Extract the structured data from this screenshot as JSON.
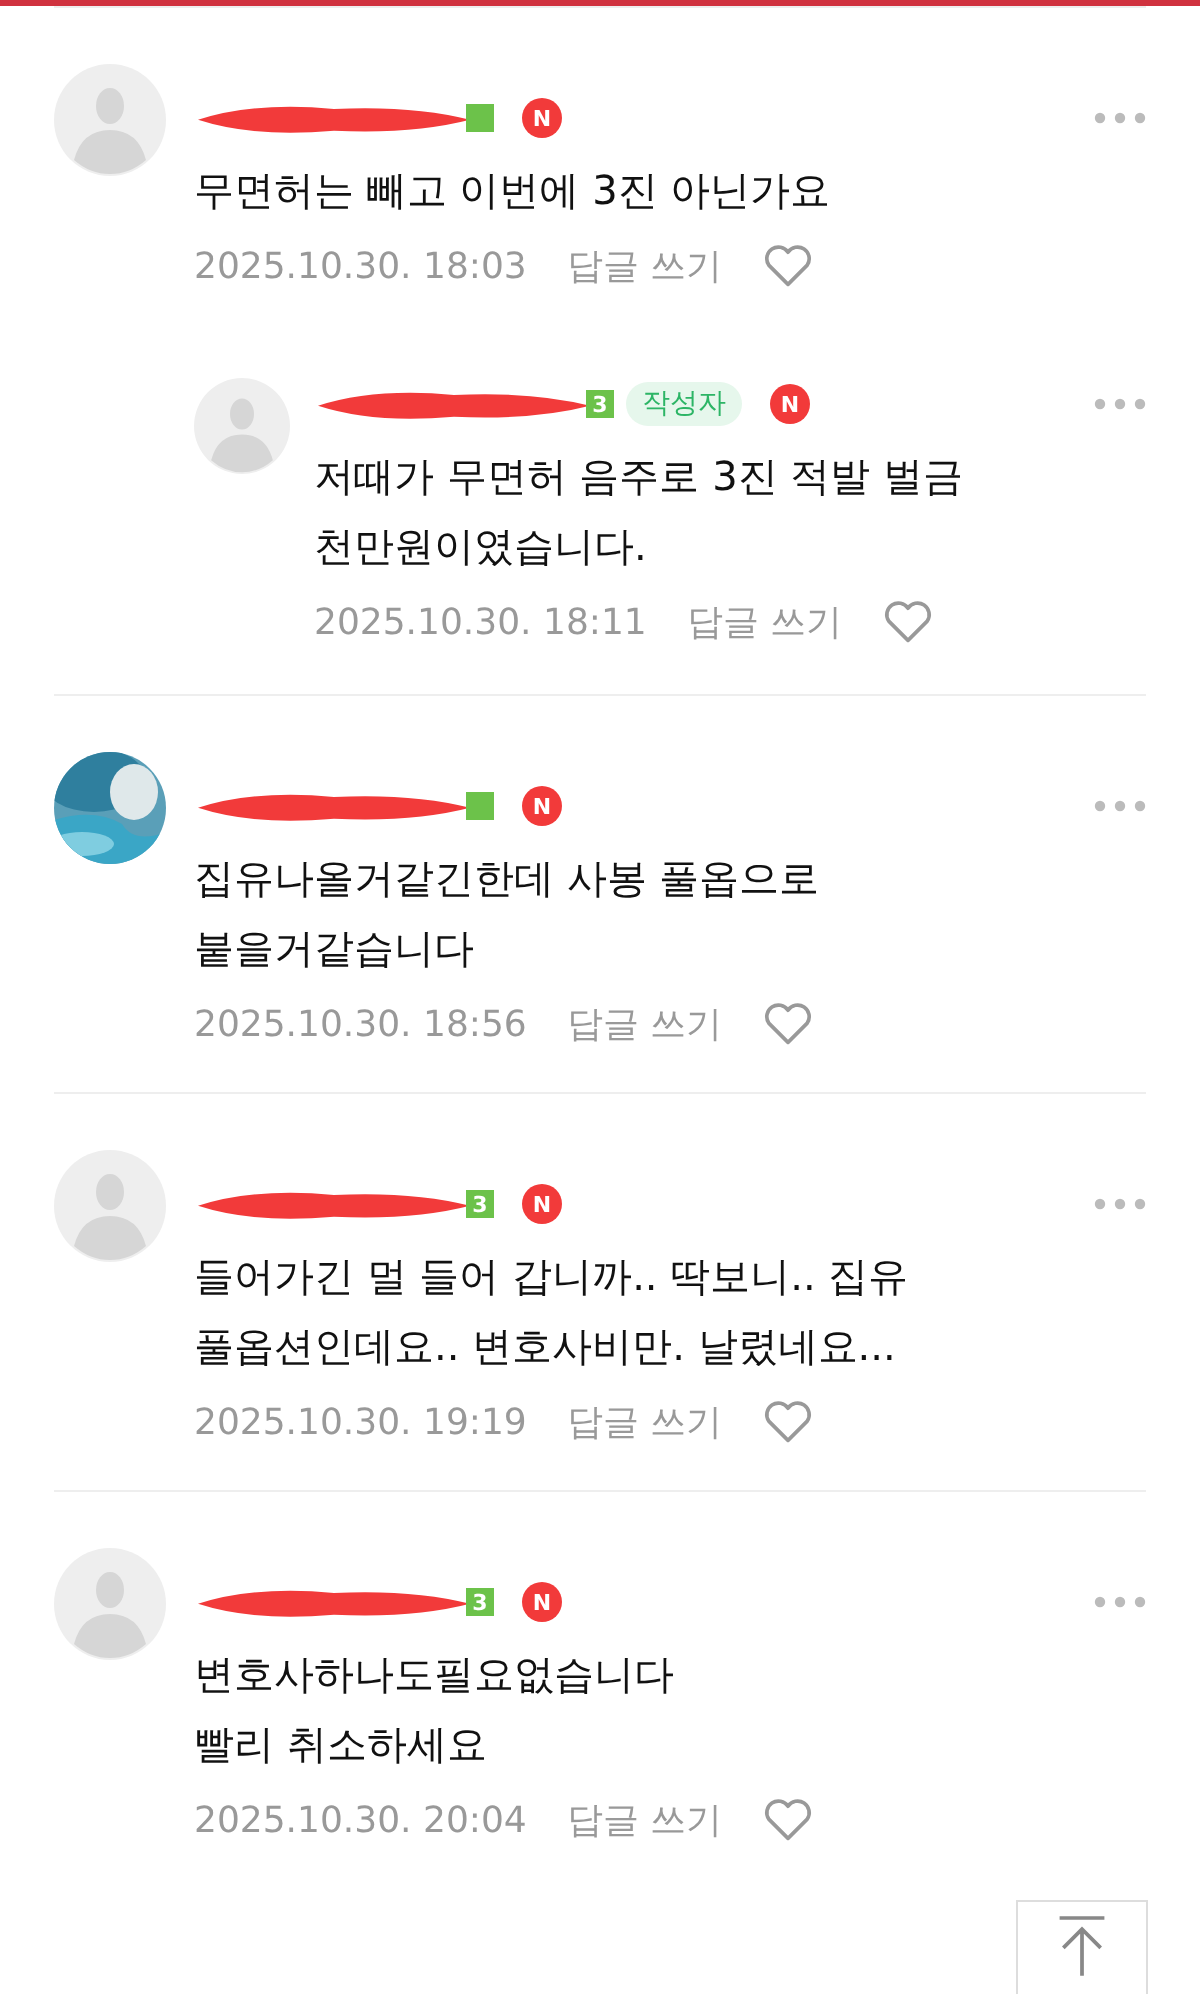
{
  "comments": [
    {
      "reply": false,
      "kind": "default",
      "author": false,
      "new_badge": "N",
      "text": "무면허는 빼고 이번에 3진 아닌가요",
      "date": "2025.10.30. 18:03",
      "reply_link": "답글 쓰기",
      "divider_after": false
    },
    {
      "reply": true,
      "kind": "default",
      "grade": "3",
      "author": true,
      "author_label": "작성자",
      "new_badge": "N",
      "text": "저때가 무면허 음주로 3진 적발 벌금\n천만원이였습니다.",
      "date": "2025.10.30. 18:11",
      "reply_link": "답글 쓰기",
      "divider_after": true
    },
    {
      "reply": false,
      "kind": "picture",
      "author": false,
      "new_badge": "N",
      "text": "집유나올거같긴한데 사봉 풀옵으로\n붙을거같습니다",
      "date": "2025.10.30. 18:56",
      "reply_link": "답글 쓰기",
      "divider_after": true
    },
    {
      "reply": false,
      "kind": "default",
      "grade": "3",
      "author": false,
      "new_badge": "N",
      "text": "들어가긴 멀 들어 갑니까.. 딱보니.. 집유\n풀옵션인데요.. 변호사비만. 날렸네요...",
      "date": "2025.10.30. 19:19",
      "reply_link": "답글 쓰기",
      "divider_after": true
    },
    {
      "reply": false,
      "kind": "default",
      "grade": "3",
      "author": false,
      "new_badge": "N",
      "text": "변호사하나도필요없습니다\n빨리 취소하세요",
      "date": "2025.10.30. 20:04",
      "reply_link": "답글 쓰기",
      "divider_after": false
    }
  ]
}
